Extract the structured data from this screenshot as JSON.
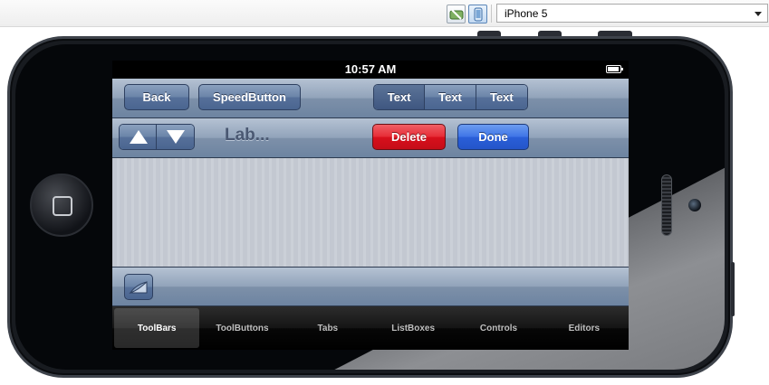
{
  "ide": {
    "device_selected": "iPhone 5",
    "orientation_buttons": [
      "landscape-icon",
      "portrait-icon"
    ]
  },
  "status": {
    "time": "10:57 AM"
  },
  "toolbar_top": {
    "back_label": "Back",
    "speed_label": "SpeedButton",
    "segments": [
      "Text",
      "Text",
      "Text"
    ],
    "selected_segment": 0
  },
  "toolbar_second": {
    "label": "Lab...",
    "delete_label": "Delete",
    "done_label": "Done",
    "delete_color": "#d8101c",
    "done_color": "#2a5fd8"
  },
  "tabs": {
    "items": [
      "ToolBars",
      "ToolButtons",
      "Tabs",
      "ListBoxes",
      "Controls",
      "Editors"
    ],
    "selected": 0
  }
}
